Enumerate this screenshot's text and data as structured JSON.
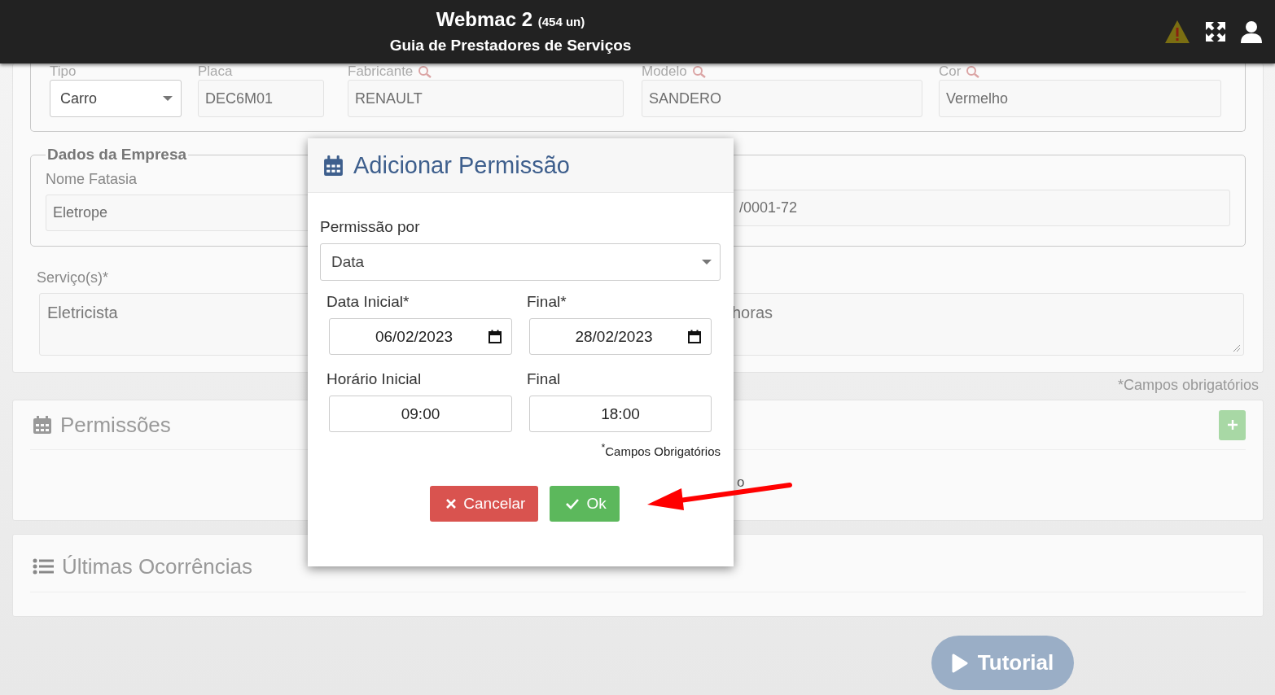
{
  "header": {
    "title": "Webmac 2",
    "count": "(454 un)",
    "subtitle": "Guia de Prestadores de Serviços"
  },
  "vehicle": {
    "fields": [
      {
        "label": "Tipo",
        "value": "Carro",
        "kind": "select"
      },
      {
        "label": "Placa",
        "value": "DEC6M01",
        "kind": "text"
      },
      {
        "label": "Fabricante",
        "value": "RENAULT",
        "kind": "search"
      },
      {
        "label": "Modelo",
        "value": "SANDERO",
        "kind": "search"
      },
      {
        "label": "Cor",
        "value": "Vermelho",
        "kind": "search"
      }
    ]
  },
  "company": {
    "legend": "Dados da Empresa",
    "name_label": "Nome Fatasia",
    "name_value": "Eletrope",
    "field_2_value": "/0001-72"
  },
  "services": {
    "label": "Serviço(s)*",
    "value": "Eletricista",
    "field_2_value": "horas"
  },
  "required_note": "*Campos obrigatórios",
  "permissions": {
    "title": "Permissões",
    "text_fragment": "o"
  },
  "occurrences": {
    "title": "Últimas Ocorrências"
  },
  "tutorial_button": "Tutorial",
  "modal": {
    "title": "Adicionar Permissão",
    "permission_by": {
      "label": "Permissão por",
      "value": "Data"
    },
    "fields": [
      {
        "label": "Data Inicial*",
        "value": "06/02/2023",
        "kind": "date"
      },
      {
        "label": "Final*",
        "value": "28/02/2023",
        "kind": "date"
      },
      {
        "label": "Horário Inicial",
        "value": "09:00",
        "kind": "time"
      },
      {
        "label": "Final",
        "value": "18:00",
        "kind": "time"
      }
    ],
    "required_note": "$^{*}$Campos Obrigatórios",
    "buttons": [
      {
        "label": "Cancelar",
        "kind": "cancel"
      },
      {
        "label": "Ok",
        "kind": "ok"
      }
    ]
  }
}
